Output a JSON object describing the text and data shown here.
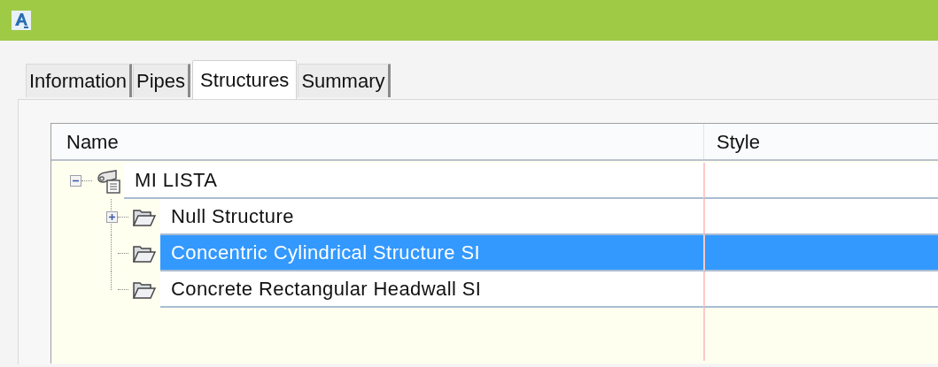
{
  "tabs": [
    {
      "label": "Information",
      "selected": false
    },
    {
      "label": "Pipes",
      "selected": false
    },
    {
      "label": "Structures",
      "selected": true
    },
    {
      "label": "Summary",
      "selected": false
    }
  ],
  "tree": {
    "columns": [
      "Name",
      "Style"
    ],
    "items": [
      {
        "name": "MI LISTA",
        "kind": "list",
        "expanded": true,
        "selected": false,
        "children": [
          {
            "name": "Null Structure",
            "kind": "folder",
            "expanded": false,
            "selected": false
          },
          {
            "name": "Concentric Cylindrical Structure SI",
            "kind": "folder",
            "selected": true
          },
          {
            "name": "Concrete Rectangular Headwall SI",
            "kind": "folder",
            "selected": false
          }
        ]
      }
    ]
  }
}
